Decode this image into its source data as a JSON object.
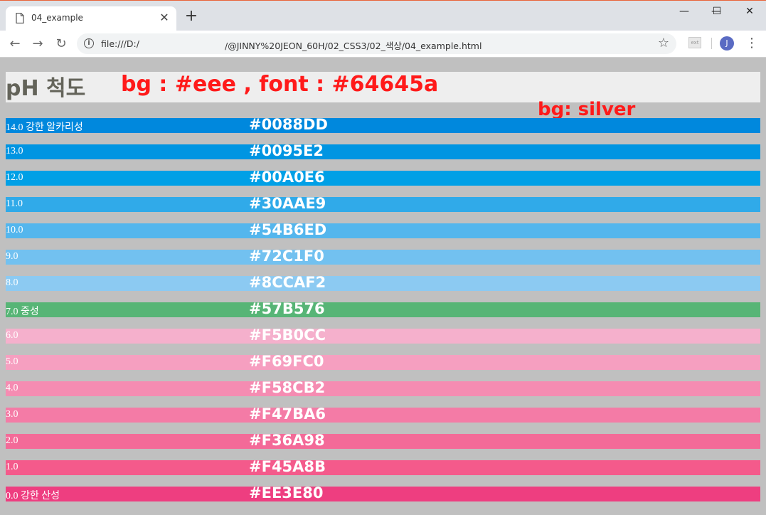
{
  "browser": {
    "tab_title": "04_example",
    "tab_close": "✕",
    "new_tab": "+",
    "url_prefix": "file:///D:/",
    "url_path": "/@JINNY%20JEON_60H/02_CSS3/02_색상/04_example.html",
    "avatar_letter": "J",
    "window_controls": {
      "minimize": "—",
      "maximize": "☐",
      "close": "✕"
    }
  },
  "page": {
    "heading": "pH 척도",
    "annotation_heading": "bg : #eee , font : #64645a",
    "annotation_bg": "bg: silver",
    "colors": {
      "page_bg": "#c0c0c0",
      "heading_bg": "#eeeeee",
      "heading_fg": "#64645a",
      "annotation": "#ff1a1a"
    },
    "rows": [
      {
        "label": "14.0 강한 알카리성",
        "hex": "#0088DD",
        "color": "#0088DD"
      },
      {
        "label": "13.0",
        "hex": "#0095E2",
        "color": "#0095E2"
      },
      {
        "label": "12.0",
        "hex": "#00A0E6",
        "color": "#00A0E6"
      },
      {
        "label": "11.0",
        "hex": "#30AAE9",
        "color": "#30AAE9"
      },
      {
        "label": "10.0",
        "hex": "#54B6ED",
        "color": "#54B6ED"
      },
      {
        "label": "9.0",
        "hex": "#72C1F0",
        "color": "#72C1F0"
      },
      {
        "label": "8.0",
        "hex": "#8CCAF2",
        "color": "#8CCAF2"
      },
      {
        "label": "7.0 중성",
        "hex": "#57B576",
        "color": "#57B576"
      },
      {
        "label": "6.0",
        "hex": "#F5B0CC",
        "color": "#F5B0CC"
      },
      {
        "label": "5.0",
        "hex": "#F69FC0",
        "color": "#F69FC0"
      },
      {
        "label": "4.0",
        "hex": "#F58CB2",
        "color": "#F58CB2"
      },
      {
        "label": "3.0",
        "hex": "#F47BA6",
        "color": "#F47BA6"
      },
      {
        "label": "2.0",
        "hex": "#F36A98",
        "color": "#F36A98"
      },
      {
        "label": "1.0",
        "hex": "#F45A8B",
        "color": "#F45A8B"
      },
      {
        "label": "0.0 강한 산성",
        "hex": "#EE3E80",
        "color": "#EE3E80"
      }
    ]
  }
}
